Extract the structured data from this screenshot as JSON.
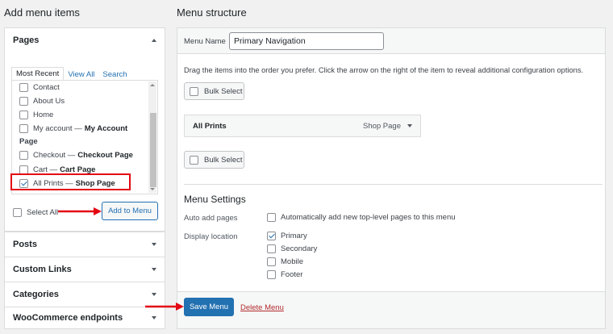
{
  "left": {
    "title": "Add menu items",
    "pages_panel": {
      "title": "Pages",
      "tabs": [
        "Most Recent",
        "View All",
        "Search"
      ],
      "items": [
        {
          "label": "Contact",
          "bold": "",
          "checked": false
        },
        {
          "label": "About Us",
          "bold": "",
          "checked": false
        },
        {
          "label": "Home",
          "bold": "",
          "checked": false
        },
        {
          "label": "My account —",
          "bold": "My Account",
          "checked": false
        },
        {
          "label": "Checkout —",
          "bold": "Checkout Page",
          "checked": false
        },
        {
          "label": "Cart —",
          "bold": "Cart Page",
          "checked": false
        },
        {
          "label": "All Prints —",
          "bold": "Shop Page",
          "checked": true
        }
      ],
      "group_label": "Page",
      "select_all": "Select All",
      "add_button": "Add to Menu"
    },
    "collapsed_panels": [
      "Posts",
      "Custom Links",
      "Categories",
      "WooCommerce endpoints"
    ]
  },
  "right": {
    "title": "Menu structure",
    "menu_name_label": "Menu Name",
    "menu_name_value": "Primary Navigation",
    "instructions": "Drag the items into the order you prefer. Click the arrow on the right of the item to reveal additional configuration options.",
    "bulk_select": "Bulk Select",
    "menu_item": {
      "title": "All Prints",
      "type": "Shop Page"
    },
    "settings": {
      "title": "Menu Settings",
      "auto_add_label": "Auto add pages",
      "auto_add_option": "Automatically add new top-level pages to this menu",
      "display_location_label": "Display location",
      "locations": [
        {
          "label": "Primary",
          "checked": true
        },
        {
          "label": "Secondary",
          "checked": false
        },
        {
          "label": "Mobile",
          "checked": false
        },
        {
          "label": "Footer",
          "checked": false
        }
      ]
    },
    "save_button": "Save Menu",
    "delete_link": "Delete Menu"
  },
  "colors": {
    "accent": "#2271b1",
    "annotation_red": "#e30613",
    "delete_red": "#b32d2e"
  }
}
